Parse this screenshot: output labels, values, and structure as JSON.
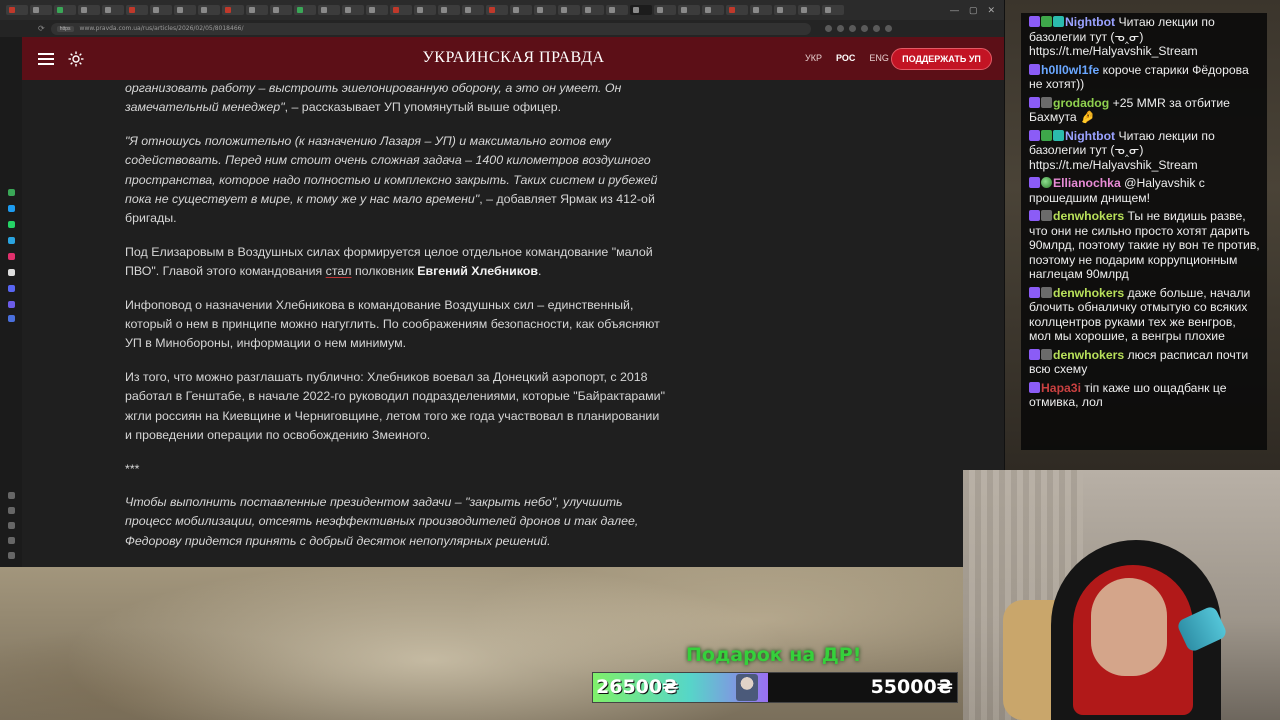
{
  "browser": {
    "url": "www.pravda.com.ua/rus/articles/2026/02/05/8018466/",
    "url_tag": "https",
    "window_controls": [
      "—",
      "▢",
      "✕"
    ]
  },
  "site": {
    "logo": "УКРАИНСКАЯ ПРАВДА",
    "languages": [
      "УКР",
      "РОС",
      "ENG"
    ],
    "active_language": "РОС",
    "support_button": "ПОДДЕРЖАТЬ УП",
    "brand_color": "#5c0f17",
    "accent_color": "#c31424"
  },
  "article": {
    "p1_italic": "организовать работу – выстроить эшелонированную оборону, а это он умеет. Он замечательный менеджер\"",
    "p1_rest": ", – рассказывает УП упомянутый выше офицер.",
    "p2_italic": "\"Я отношусь положительно (к назначению Лазаря – УП) и максимально готов ему содействовать. Перед ним стоит очень сложная задача – 1400 километров воздушного пространства, которое надо полностью и комплексно закрыть. Таких систем и рубежей пока не существует в мире, к тому же у нас мало времени\"",
    "p2_rest": ", – добавляет Ярмак из 412-ой бригады.",
    "p3_a": "Под Елизаровым в Воздушных силах формируется целое отдельное командование \"малой ПВО\". Главой этого командования ",
    "p3_link": "стал",
    "p3_b": " полковник ",
    "p3_bold": "Евгений Хлебников",
    "p3_end": ".",
    "p4": "Инфоповод о назначении Хлебникова в командование Воздушных сил – единственный, который о нем в принципе можно нагуглить. По соображениям безопасности, как объясняют УП в Минобороны, информации о нем минимум.",
    "p5": "Из того, что можно разглашать публично: Хлебников воевал за Донецкий аэропорт, с 2018 работал в Генштабе, в начале 2022-го руководил подразделениями, которые \"Байрактарами\" жгли россиян на Киевщине и Черниговщине, летом того же года участвовал в планировании и проведении операции по освобождению Змеиного.",
    "separator": "***",
    "p6_italic": "Чтобы выполнить поставленные президентом задачи – \"закрыть небо\", улучшить процесс мобилизации, отсеять неэффективных производителей дронов и так далее, Федорову придется принять с добрый десяток непопулярных решений."
  },
  "chat": [
    {
      "user": "Nightbot",
      "text": "Читаю лекции по базолегии тут (ᓀ‸ᓂ) https://t.me/Halyavshik_Stream",
      "badges": [
        "b-purple",
        "b-green",
        "b-teal"
      ],
      "color": "c-bot"
    },
    {
      "user": "h0ll0wl1fe",
      "text": "короче старики Фёдорова не хотят))",
      "badges": [
        "b-purple"
      ],
      "color": "c-blue"
    },
    {
      "user": "grodadog",
      "text": "+25 MMR за отбитие Бахмута 🤌",
      "badges": [
        "b-purple",
        "b-grey"
      ],
      "color": "c-green"
    },
    {
      "user": "Nightbot",
      "text": "Читаю лекции по базолегии тут (ᓀ‸ᓂ) https://t.me/Halyavshik_Stream",
      "badges": [
        "b-purple",
        "b-green",
        "b-teal"
      ],
      "color": "c-bot"
    },
    {
      "user": "Ellianochka",
      "text": "@Halyavshik с прошедшим днищем!",
      "badges": [
        "b-purple",
        "b-globe"
      ],
      "color": "c-pink"
    },
    {
      "user": "denwhokers",
      "text": "Ты не видишь разве, что они не сильно просто хотят дарить 90млрд, поэтому такие ну вон те против, поэтому не подарим коррупционным наглецам 90млрд",
      "badges": [
        "b-purple",
        "b-grey"
      ],
      "color": "c-lime"
    },
    {
      "user": "denwhokers",
      "text": "даже больше, начали блочить обналичку отмытую со всяких коллцентров руками тех же венгров, мол мы хорошие, а венгры плохие",
      "badges": [
        "b-purple",
        "b-grey"
      ],
      "color": "c-lime"
    },
    {
      "user": "denwhokers",
      "text": "люся расписал почти всю схему",
      "badges": [
        "b-purple",
        "b-grey"
      ],
      "color": "c-lime"
    },
    {
      "user": "Hapa3i",
      "text": "тіп каже шо ощадбанк це отмивка, лол",
      "badges": [
        "b-purple"
      ],
      "color": "c-red"
    }
  ],
  "donation": {
    "title": "Подарок на ДР!",
    "current": "26500₴",
    "target": "55000₴",
    "progress": 0.48
  }
}
